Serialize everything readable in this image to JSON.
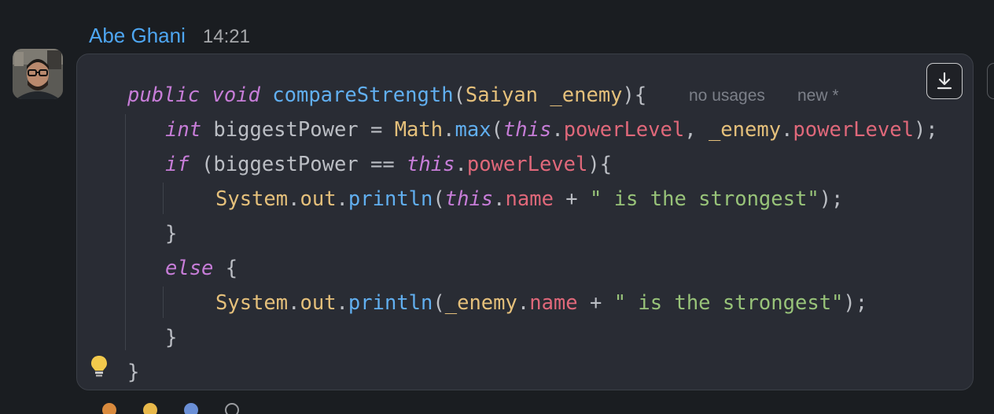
{
  "message": {
    "author": "Abe Ghani",
    "time": "14:21",
    "avatar_icon": "user-avatar-photo"
  },
  "code_block": {
    "download_icon": "download-icon",
    "lightbulb_icon": "lightbulb-icon",
    "hints": {
      "usages": "no usages",
      "status": "new *"
    },
    "lines": [
      {
        "tokens": [
          [
            "public",
            "kw"
          ],
          [
            " ",
            "plain"
          ],
          [
            "void",
            "kw"
          ],
          [
            " ",
            "plain"
          ],
          [
            "compareStrength",
            "fn"
          ],
          [
            "(",
            "plain"
          ],
          [
            "Saiyan",
            "type"
          ],
          [
            " ",
            "plain"
          ],
          [
            "_enemy",
            "type"
          ],
          [
            "){",
            "plain"
          ]
        ]
      },
      {
        "tokens": [
          [
            "int",
            "kw"
          ],
          [
            " biggestPower = ",
            "plain"
          ],
          [
            "Math",
            "type"
          ],
          [
            ".",
            "plain"
          ],
          [
            "max",
            "fn"
          ],
          [
            "(",
            "plain"
          ],
          [
            "this",
            "kw"
          ],
          [
            ".",
            "plain"
          ],
          [
            "powerLevel",
            "field"
          ],
          [
            ", ",
            "plain"
          ],
          [
            "_enemy",
            "type"
          ],
          [
            ".",
            "plain"
          ],
          [
            "powerLevel",
            "field"
          ],
          [
            ");",
            "plain"
          ]
        ]
      },
      {
        "tokens": [
          [
            "if",
            "kw"
          ],
          [
            " (biggestPower == ",
            "plain"
          ],
          [
            "this",
            "kw"
          ],
          [
            ".",
            "plain"
          ],
          [
            "powerLevel",
            "field"
          ],
          [
            "){",
            "plain"
          ]
        ]
      },
      {
        "tokens": [
          [
            "System",
            "type"
          ],
          [
            ".",
            "plain"
          ],
          [
            "out",
            "type"
          ],
          [
            ".",
            "plain"
          ],
          [
            "println",
            "fn"
          ],
          [
            "(",
            "plain"
          ],
          [
            "this",
            "kw"
          ],
          [
            ".",
            "plain"
          ],
          [
            "name",
            "field"
          ],
          [
            " + ",
            "plain"
          ],
          [
            "\" is the strongest\"",
            "str"
          ],
          [
            ");",
            "plain"
          ]
        ]
      },
      {
        "tokens": [
          [
            "}",
            "plain"
          ]
        ]
      },
      {
        "tokens": [
          [
            "else",
            "kw"
          ],
          [
            " {",
            "plain"
          ]
        ]
      },
      {
        "tokens": [
          [
            "System",
            "type"
          ],
          [
            ".",
            "plain"
          ],
          [
            "out",
            "type"
          ],
          [
            ".",
            "plain"
          ],
          [
            "println",
            "fn"
          ],
          [
            "(",
            "plain"
          ],
          [
            "_enemy",
            "type"
          ],
          [
            ".",
            "plain"
          ],
          [
            "name",
            "field"
          ],
          [
            " + ",
            "plain"
          ],
          [
            "\" is the strongest\"",
            "str"
          ],
          [
            ");",
            "plain"
          ]
        ]
      },
      {
        "tokens": [
          [
            "}",
            "plain"
          ]
        ]
      },
      {
        "tokens": [
          [
            "}",
            "plain"
          ]
        ]
      }
    ]
  },
  "colors": {
    "background": "#1a1d21",
    "author": "#4ea6f2",
    "keyword": "#c77dd8",
    "function": "#61aff0",
    "type": "#e5c07b",
    "field": "#e0687a",
    "string": "#98c379"
  }
}
